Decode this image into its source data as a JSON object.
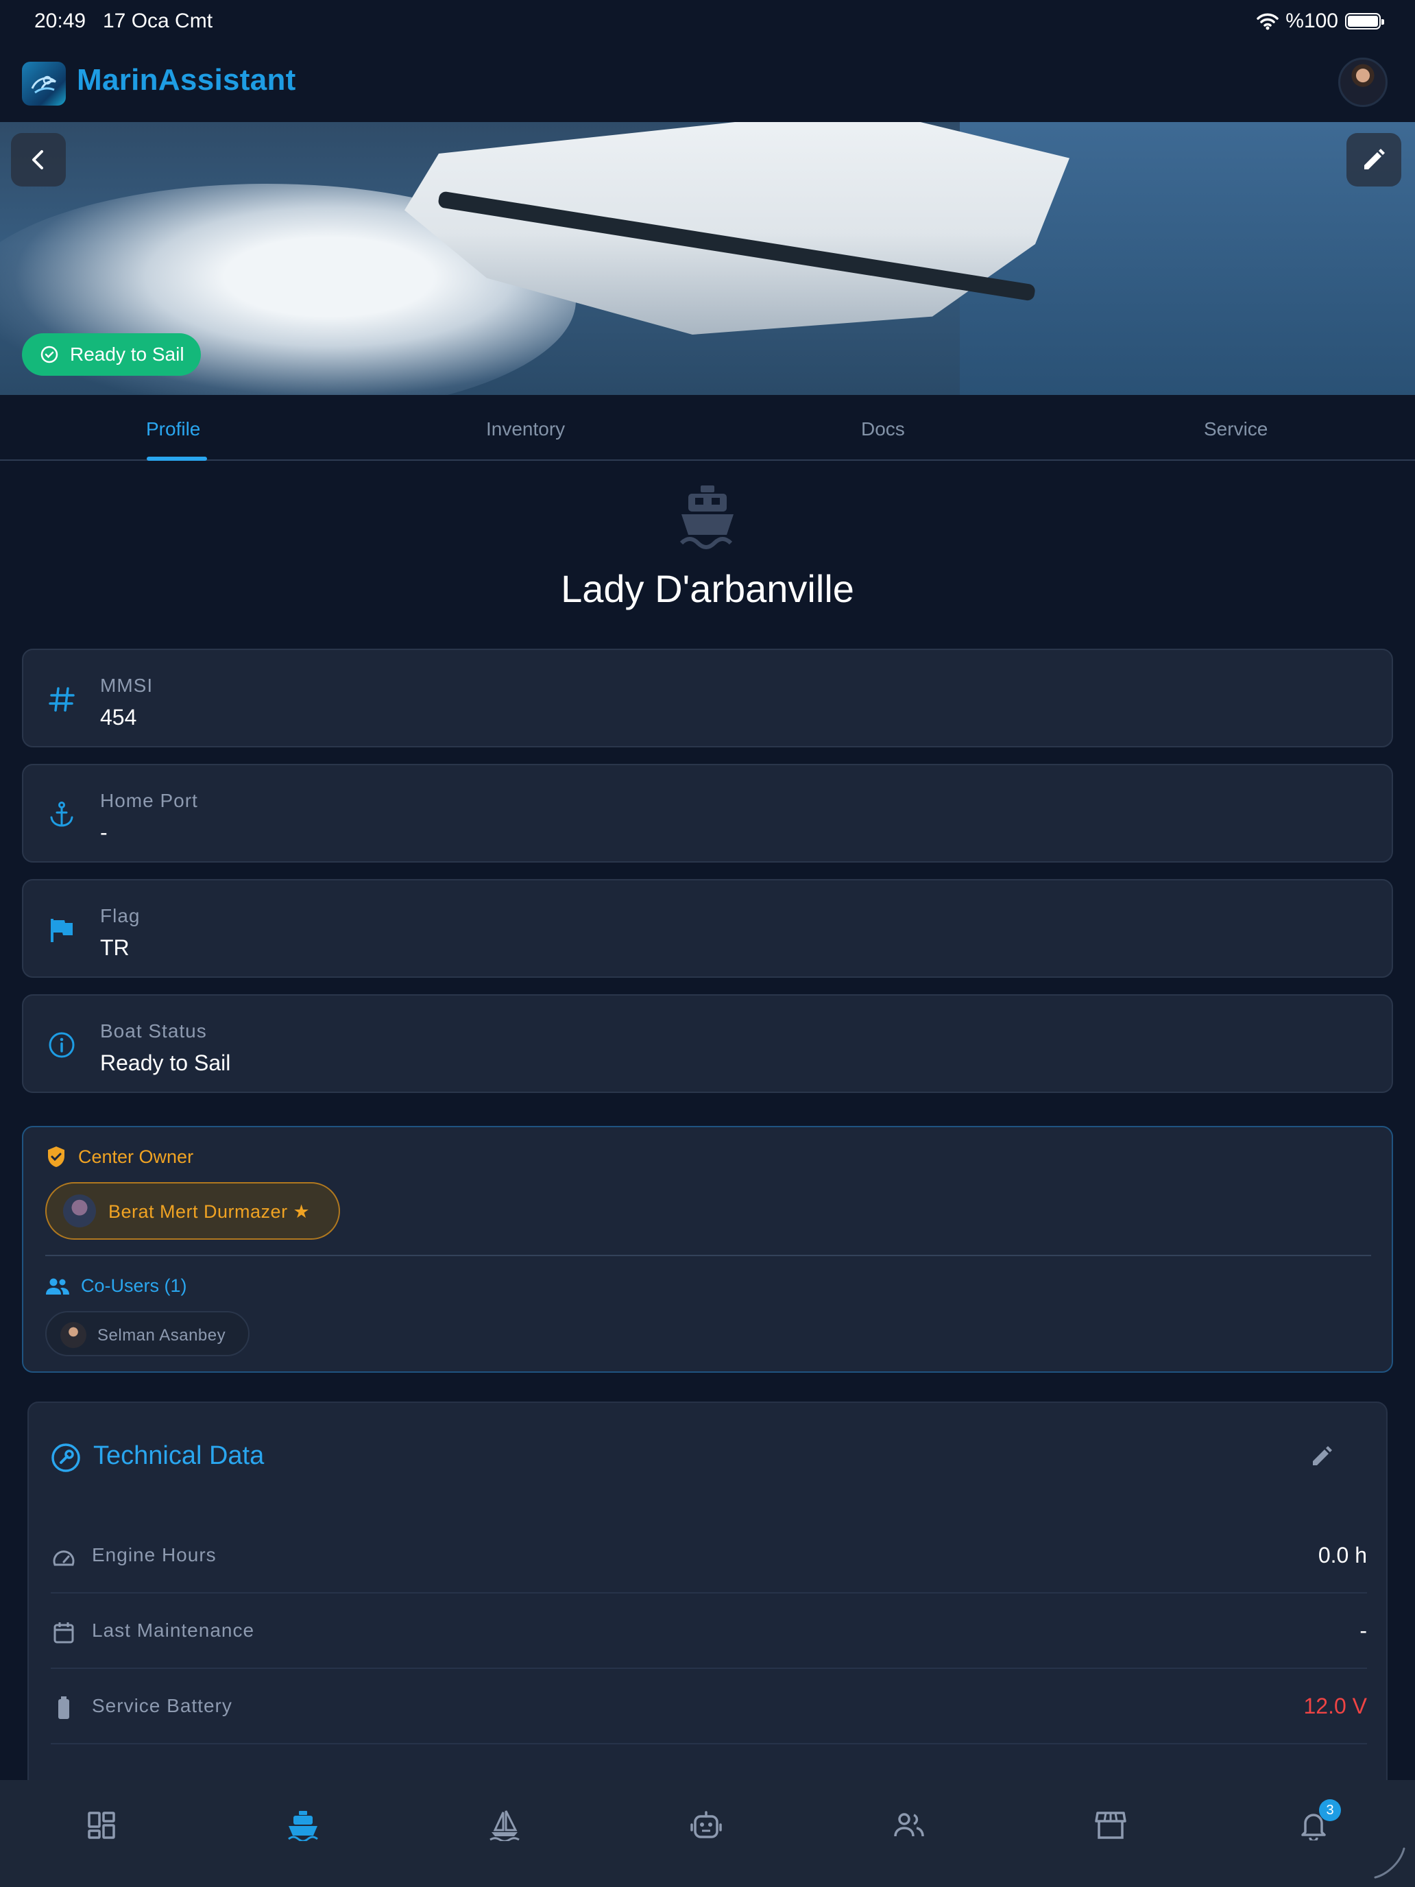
{
  "status_bar": {
    "time": "20:49",
    "date": "17 Oca Cmt",
    "battery": "%100"
  },
  "app": {
    "title": "MarinAssistant"
  },
  "hero": {
    "status_badge": "Ready to Sail"
  },
  "tabs": [
    {
      "label": "Profile",
      "active": true
    },
    {
      "label": "Inventory",
      "active": false
    },
    {
      "label": "Docs",
      "active": false
    },
    {
      "label": "Service",
      "active": false
    }
  ],
  "boat": {
    "name": "Lady D'arbanville"
  },
  "info": [
    {
      "icon": "hash-icon",
      "label": "MMSI",
      "value": "454"
    },
    {
      "icon": "anchor-icon",
      "label": "Home Port",
      "value": "-"
    },
    {
      "icon": "flag-icon",
      "label": "Flag",
      "value": "TR"
    },
    {
      "icon": "info-icon",
      "label": "Boat Status",
      "value": "Ready to Sail"
    }
  ],
  "owners": {
    "center_owner_label": "Center Owner",
    "center_owner_name": "Berat Mert Durmazer ★",
    "co_users_label": "Co-Users (1)",
    "co_users": [
      {
        "name": "Selman Asanbey"
      }
    ]
  },
  "technical": {
    "title": "Technical Data",
    "rows": [
      {
        "icon": "gauge-icon",
        "label": "Engine Hours",
        "value": "0.0 h",
        "color": "#ffffff"
      },
      {
        "icon": "calendar-icon",
        "label": "Last Maintenance",
        "value": "-",
        "color": "#ffffff"
      },
      {
        "icon": "battery-icon",
        "label": "Service Battery",
        "value": "12.0 V",
        "color": "#ef4444"
      }
    ]
  },
  "bottom_nav": {
    "notifications_count": "3"
  },
  "colors": {
    "accent": "#1e9de4",
    "success": "#14b87a",
    "warning": "#f0a323",
    "danger": "#ef4444",
    "background": "#0d1628",
    "card": "#1c2639"
  }
}
